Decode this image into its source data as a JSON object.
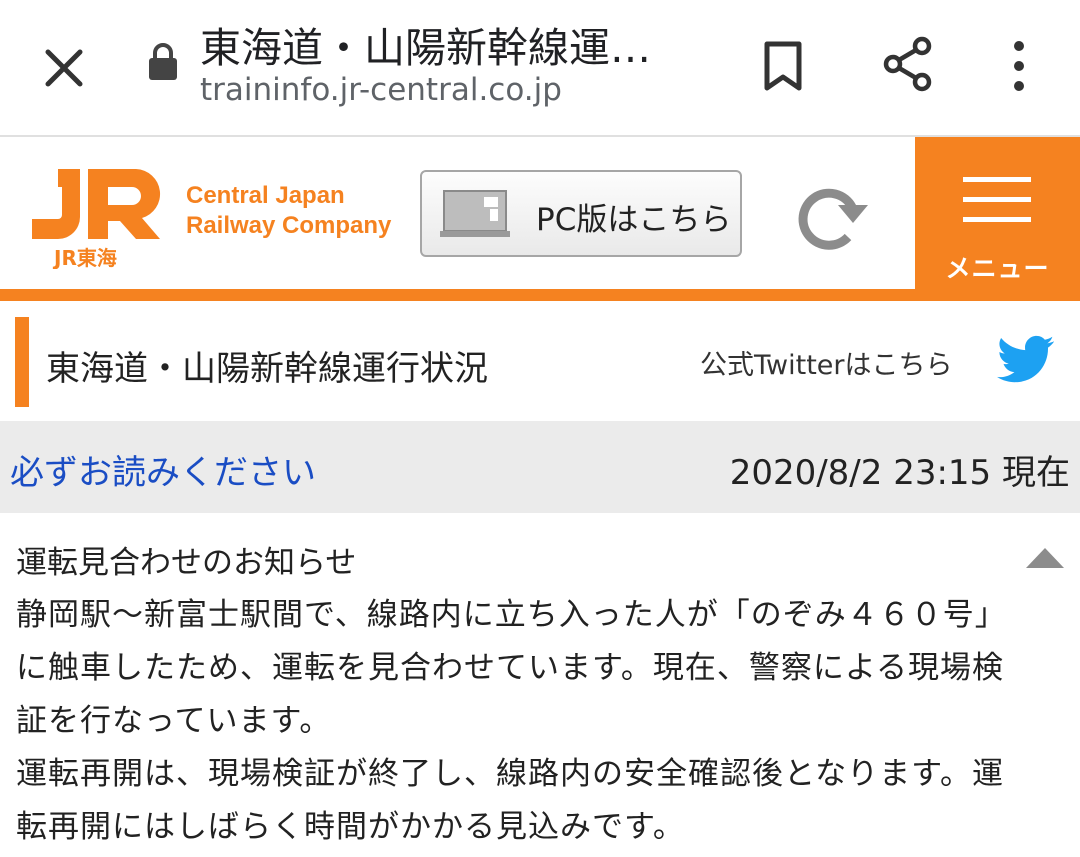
{
  "browser": {
    "page_title": "東海道・山陽新幹線運…",
    "url": "traininfo.jr-central.co.jp",
    "icons": [
      "close-icon",
      "lock-icon",
      "bookmark-icon",
      "share-icon",
      "more-vert-icon"
    ]
  },
  "site_header": {
    "logo_text": "JR東海",
    "brand_line1": "Central Japan",
    "brand_line2": "Railway Company",
    "pc_button_label": "PC版はこちら",
    "menu_label": "メニュー",
    "accent_color": "#f58220",
    "icons": [
      "pc-icon",
      "refresh-icon",
      "hamburger-icon"
    ]
  },
  "section": {
    "title": "東海道・山陽新幹線運行状況",
    "twitter_link": "公式Twitterはこちら",
    "twitter_color": "#1da1f2"
  },
  "notice_bar": {
    "must_read": "必ずお読みください",
    "timestamp": "2020/8/2 23:15 現在",
    "link_color": "#1a4dc4"
  },
  "notice": {
    "heading": "運転見合わせのお知らせ",
    "body": "静岡駅～新富士駅間で、線路内に立ち入った人が「のぞみ４６０号」に触車したため、運転を見合わせています。現在、警察による現場検証を行なっています。\n運転再開は、現場検証が終了し、線路内の安全確認後となります。運転再開にはしばらく時間がかかる見込みです。"
  }
}
